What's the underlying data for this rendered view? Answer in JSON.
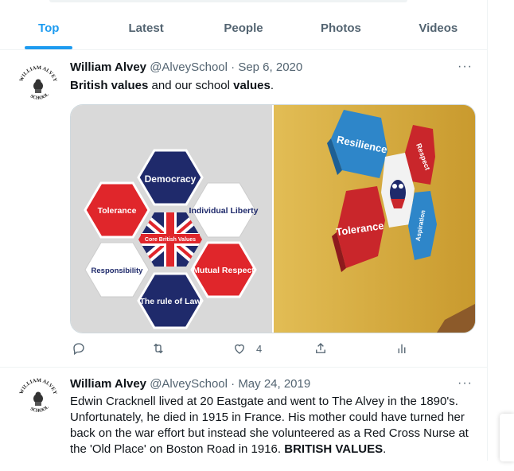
{
  "tabs": [
    {
      "label": "Top",
      "active": true
    },
    {
      "label": "Latest",
      "active": false
    },
    {
      "label": "People",
      "active": false
    },
    {
      "label": "Photos",
      "active": false
    },
    {
      "label": "Videos",
      "active": false
    }
  ],
  "tweets": [
    {
      "name": "William Alvey",
      "handle": "@AlveySchool",
      "sep": " · ",
      "date": "Sep 6, 2020",
      "avatar_text_top": "WILLIAM ALVEY",
      "avatar_text_bottom": "SCHOOL",
      "text_parts": [
        {
          "t": "British values",
          "b": true
        },
        {
          "t": " and our school ",
          "b": false
        },
        {
          "t": "values",
          "b": true
        },
        {
          "t": ".",
          "b": false
        }
      ],
      "media_left": {
        "center": "Core British Values",
        "hexes": [
          "Democracy",
          "Individual Liberty",
          "Mutual Respect",
          "The rule of Law",
          "Responsibility",
          "Tolerance"
        ]
      },
      "media_right": {
        "panels": [
          "Resilience",
          "Respect",
          "Tolerance",
          "Aspiration"
        ]
      },
      "likes": "4"
    },
    {
      "name": "William Alvey",
      "handle": "@AlveySchool",
      "sep": " · ",
      "date": "May 24, 2019",
      "avatar_text_top": "WILLIAM ALVEY",
      "avatar_text_bottom": "SCHOOL",
      "lines": [
        "Edwin Cracknell lived at 20 Eastgate and went to The Alvey in the 1890's.",
        "Unfortunately, he died in 1915 in France. His mother could have turned her",
        "back on the war effort but instead she volunteered as a Red Cross Nurse at",
        "the 'Old Place' on Boston Road in 1916. "
      ],
      "bold_tail": "BRITISH VALUES",
      "tail": "."
    }
  ],
  "more_label": "···",
  "colors": {
    "accent": "#1d9bf0",
    "navy": "#1f2a6b",
    "red": "#e0262b"
  }
}
